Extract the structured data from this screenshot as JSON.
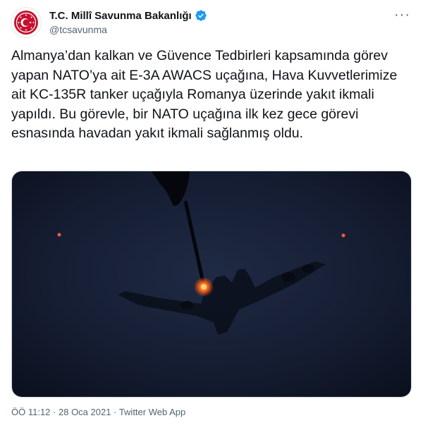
{
  "account": {
    "display_name": "T.C. Millî Savunma Bakanlığı",
    "handle": "@tcsavunma",
    "verified": true,
    "avatar_icon": "msb-emblem-icon",
    "accent_color": "#c8102e"
  },
  "tweet": {
    "text": "Almanya’dan kalkan ve Güvence Tedbirleri kapsamında görev yapan NATO’ya ait E-3A AWACS uçağına, Hava Kuvvetlerimize ait KC-135R tanker uçağıyla Romanya üzerinde yakıt ikmali yapıldı. Bu görevle, bir NATO uçağına ilk kez gece görevi esnasında havadan yakıt ikmali sağlanmış oldu.",
    "media_icon": "aerial-refueling-night-photo"
  },
  "meta": {
    "time": "ÖÖ 11:12",
    "separator": "·",
    "date": "28 Oca 2021",
    "source": "Twitter Web App"
  },
  "colors": {
    "verified_blue": "#1d9bf0",
    "text_primary": "#0f1419",
    "text_secondary": "#536471"
  }
}
